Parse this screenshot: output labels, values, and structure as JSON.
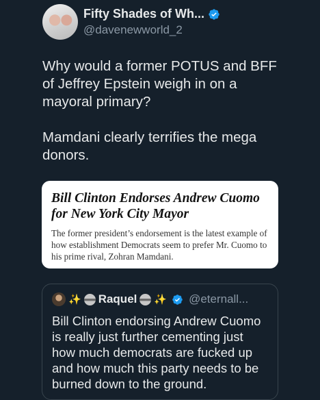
{
  "tweet": {
    "display_name": "Fifty Shades of Wh...",
    "handle": "@davenewworld_2",
    "paragraphs": [
      "Why would a former POTUS and BFF of Jeffrey Epstein weigh in on a mayoral primary?",
      "Mamdani clearly terrifies the mega donors."
    ]
  },
  "link_card": {
    "headline": "Bill Clinton Endorses Andrew Cuomo for New York City Mayor",
    "summary": "The former president’s endorsement is the latest example of how establishment Democrats seem to prefer Mr. Cuomo to his prime rival, Zohran Mamdani."
  },
  "quote": {
    "sparkle_left": "✨",
    "display_name": "Raquel",
    "sparkle_right": "✨",
    "handle": "@eternall...",
    "text": "Bill Clinton endorsing Andrew Cuomo is really just further cementing just how much democrats are fucked up and how much this party needs to be burned down to the ground."
  },
  "colors": {
    "background": "#15202b",
    "verified": "#1d9bf0",
    "secondary_text": "#8b98a5"
  }
}
